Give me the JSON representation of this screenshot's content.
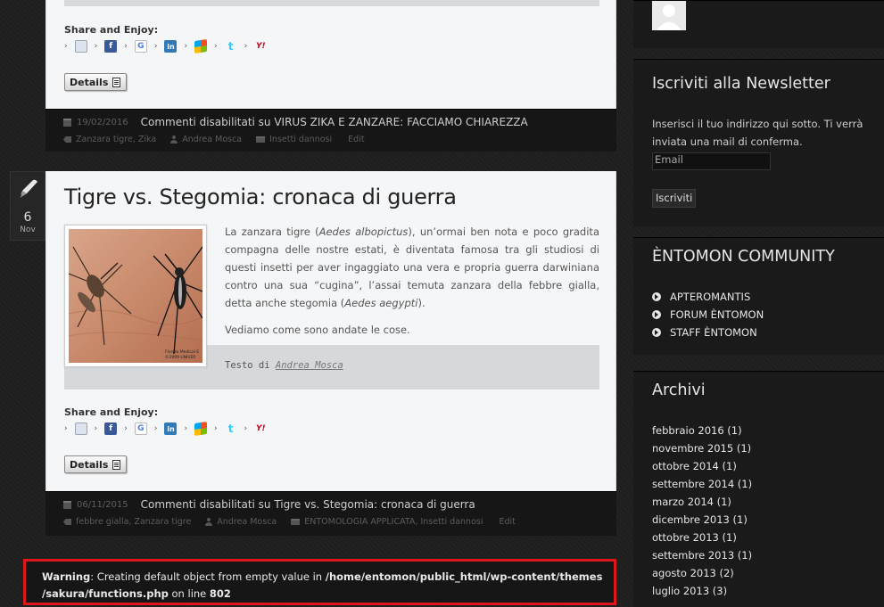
{
  "share": {
    "title": "Share and Enjoy:",
    "details_label": "Details",
    "icons": {
      "mail": "mail-icon",
      "facebook": "f",
      "google": "G",
      "linkedin": "in",
      "windows": "windows-live-icon",
      "twitter": "t",
      "yahoo": "Y!"
    }
  },
  "posts": [
    {
      "date": "19/02/2016",
      "comments": "Commenti disabilitati su VIRUS ZIKA E ZANZARE: FACCIAMO CHIAREZZA",
      "tags": "Zanzara tigre, Zika",
      "author": "Andrea Mosca",
      "category": "Insetti dannosi",
      "edit": "Edit"
    },
    {
      "badge_day": "6",
      "badge_month": "Nov",
      "title": "Tigre vs. Stegomia: cronaca di guerra",
      "image_caption_1": "Florida Medical E",
      "image_caption_2": "©1999 UNIVER",
      "para1_a": "La zanzara tigre (",
      "para1_species1": "Aedes albopictus",
      "para1_b": "), un’ormai ben nota e poco gradita compagna delle nostre estati, è diventata famosa tra gli studiosi di questi insetti per aver ingaggiato una vera e propria guerra darwiniana contro una sua “cugina”, l’assai temuta zanzara della febbre gialla, detta anche stegomia (",
      "para1_species2": "Aedes aegypti",
      "para1_c": ").",
      "para2": "Vediamo come sono andate le cose.",
      "credit_prefix": "Testo di ",
      "credit_author": "Andrea Mosca",
      "date": "06/11/2015",
      "comments": "Commenti disabilitati su Tigre vs. Stegomia: cronaca di guerra",
      "tags": "febbre gialla, Zanzara tigre",
      "author": "Andrea Mosca",
      "category": "ENTOMOLOGIA APPLICATA, Insetti dannosi",
      "edit": "Edit"
    }
  ],
  "warning": {
    "label": "Warning",
    "msg1": ": Creating default object from empty value in ",
    "path1": "/home/entomon/public_html/wp-content/themes",
    "path2": "/sakura/functions.php",
    "msg2": " on line ",
    "line": "802"
  },
  "sidebar": {
    "newsletter": {
      "title": "Iscriviti alla Newsletter",
      "text": "Inserisci il tuo indirizzo qui sotto. Ti verrà inviata una mail di conferma.",
      "email_placeholder": "Email",
      "subscribe_label": "Iscriviti"
    },
    "community": {
      "title": "ÈNTOMON COMMUNITY",
      "items": [
        "APTEROMANTIS",
        "FORUM ÈNTOMON",
        "STAFF ÈNTOMON"
      ]
    },
    "archives": {
      "title": "Archivi",
      "items": [
        "febbraio 2016 (1)",
        "novembre 2015 (1)",
        "ottobre 2014 (1)",
        "settembre 2014 (1)",
        "marzo 2014 (1)",
        "dicembre 2013 (1)",
        "ottobre 2013 (1)",
        "settembre 2013 (1)",
        "agosto 2013 (2)",
        "luglio 2013 (3)"
      ]
    }
  },
  "colors": {
    "background": "#1f1f1f",
    "card": "#f5f6f8",
    "meta_bar": "#161616",
    "warning_border": "#e0161d"
  }
}
